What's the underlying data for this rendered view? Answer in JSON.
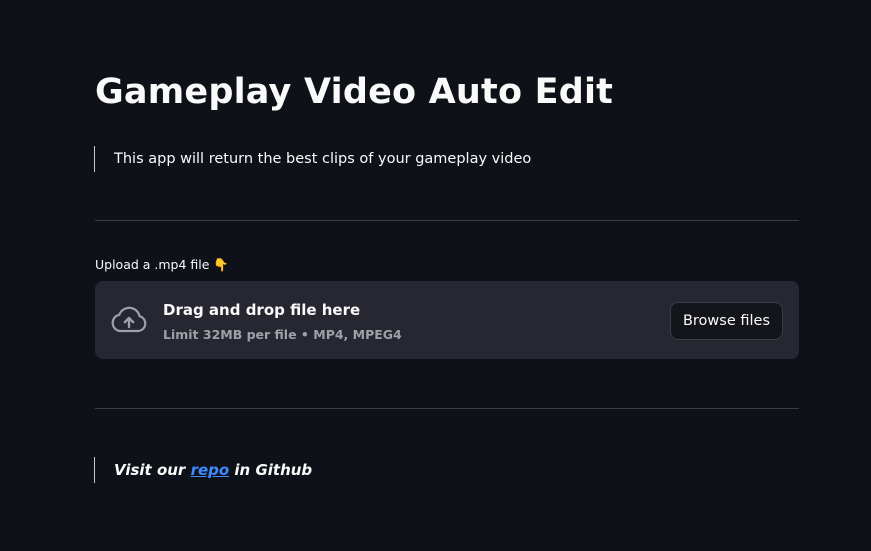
{
  "title": "Gameplay Video Auto Edit",
  "description": "This app will return the best clips of your gameplay video",
  "uploader": {
    "label": "Upload a .mp4 file 👇",
    "drop_title": "Drag and drop file here",
    "limit_text": "Limit 32MB per file • MP4, MPEG4",
    "browse_label": "Browse files",
    "icon": "cloud-upload-icon"
  },
  "footer": {
    "prefix": "Visit our ",
    "link_text": "repo",
    "suffix": " in Github"
  },
  "colors": {
    "background": "#0e1117",
    "dropzone": "#262730",
    "link": "#3d8bff",
    "muted_text": "#9ea1a8"
  }
}
